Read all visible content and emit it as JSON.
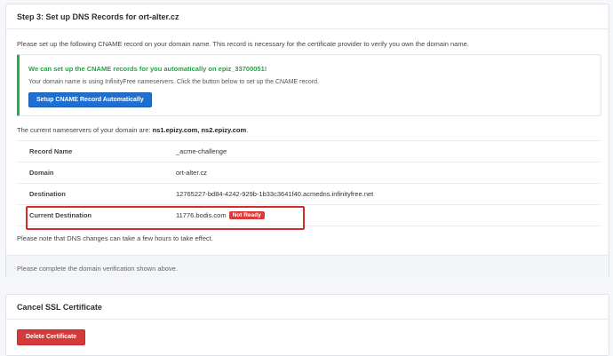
{
  "step": {
    "title": "Step 3: Set up DNS Records for ort-alter.cz",
    "intro": "Please set up the following CNAME record on your domain name. This record is necessary for the certificate provider to verify you own the domain name.",
    "callout": {
      "title": "We can set up the CNAME records for you automatically on epiz_33700051!",
      "body": "Your domain name is using InfinityFree nameservers. Click the button below to set up the CNAME record.",
      "button_label": "Setup CNAME Record Automatically"
    },
    "nameservers": {
      "prefix": "The current nameservers of your domain are:",
      "ns1": "ns1.epizy.com",
      "separator": ", ",
      "ns2": "ns2.epizy.com",
      "suffix": "."
    },
    "records": [
      {
        "label": "Record Name",
        "value": "_acme-challenge"
      },
      {
        "label": "Domain",
        "value": "ort-alter.cz"
      },
      {
        "label": "Destination",
        "value": "12765227-bd84-4242-929b-1b33c3641f40.acmedns.infinityfree.net"
      },
      {
        "label": "Current Destination",
        "value": "11776.bodis.com",
        "badge": "Not Ready"
      }
    ],
    "dns_note": "Please note that DNS changes can take a few hours to take effect.",
    "footer": "Please complete the domain verification shown above."
  },
  "cancel": {
    "title": "Cancel SSL Certificate",
    "button_label": "Delete Certificate"
  },
  "colors": {
    "success": "#27a24a",
    "primary": "#1f6fd1",
    "danger": "#d43a3a"
  }
}
